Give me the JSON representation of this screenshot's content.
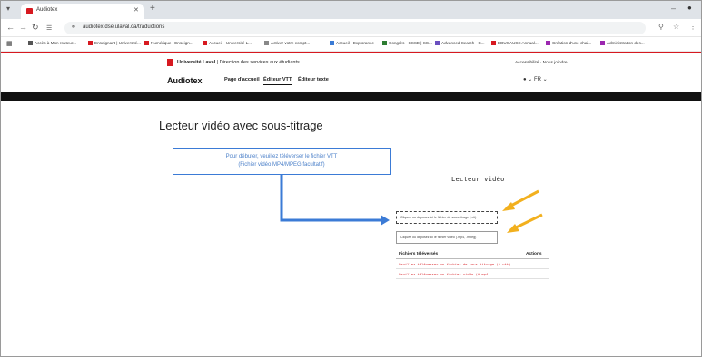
{
  "browser": {
    "tab_title": "Audiotex",
    "url": "audiotex.dse.ulaval.ca/traductions",
    "bookmarks": [
      {
        "label": "Accès à Mon routeur...",
        "color": "#555555"
      },
      {
        "label": "Enseignant | Université...",
        "color": "#d71920"
      },
      {
        "label": "Numérique | Enseign...",
        "color": "#d71920"
      },
      {
        "label": "Accueil · Université L...",
        "color": "#d71920"
      },
      {
        "label": "Activer votre compt...",
        "color": "#888888"
      },
      {
        "label": "Accueil · Explorance",
        "color": "#3a7bd5"
      },
      {
        "label": "Congrès · CSSE | SC...",
        "color": "#2e7d32"
      },
      {
        "label": "Advanced Search · C...",
        "color": "#6a4fbf"
      },
      {
        "label": "EDUCAUSE Annual...",
        "color": "#d71920"
      },
      {
        "label": "Création d'une chai...",
        "color": "#9c27b0"
      },
      {
        "label": "Administration des...",
        "color": "#9c27b0"
      }
    ]
  },
  "site": {
    "university": "Université Laval",
    "department": "Direction des services aux étudiants",
    "top_links": "Accessibilité · Nous joindre",
    "brand": "Audiotex",
    "nav": [
      "Page d'accueil",
      "Éditeur VTT",
      "Éditeur texte"
    ],
    "user": "FR"
  },
  "main": {
    "title": "Lecteur vidéo avec sous-titrage",
    "intro_line1": "Pour débuter, veuillez téléverser le fichier VTT",
    "intro_line2": "(Fichier vidéo MP4/MPEG facultatif)",
    "player_title": "Lecteur vidéo",
    "upload_vtt": "Cliquez ou déposez ici le fichier de sous-titrage (.vtt)",
    "upload_video": "Cliquez ou déposez ici le fichier vidéo (.mp4, .mpeg)",
    "files_header": "Fichiers téléversés",
    "actions_header": "Actions",
    "file_rows": [
      "Veuillez téléverser un fichier de sous-titrage (*.vtt)",
      "Veuillez téléverser un fichier vidéo (*.mp4)"
    ]
  },
  "colors": {
    "brand_red": "#d71920",
    "callout_blue": "#3b7bd6",
    "annotation_yellow": "#f2b01e"
  }
}
